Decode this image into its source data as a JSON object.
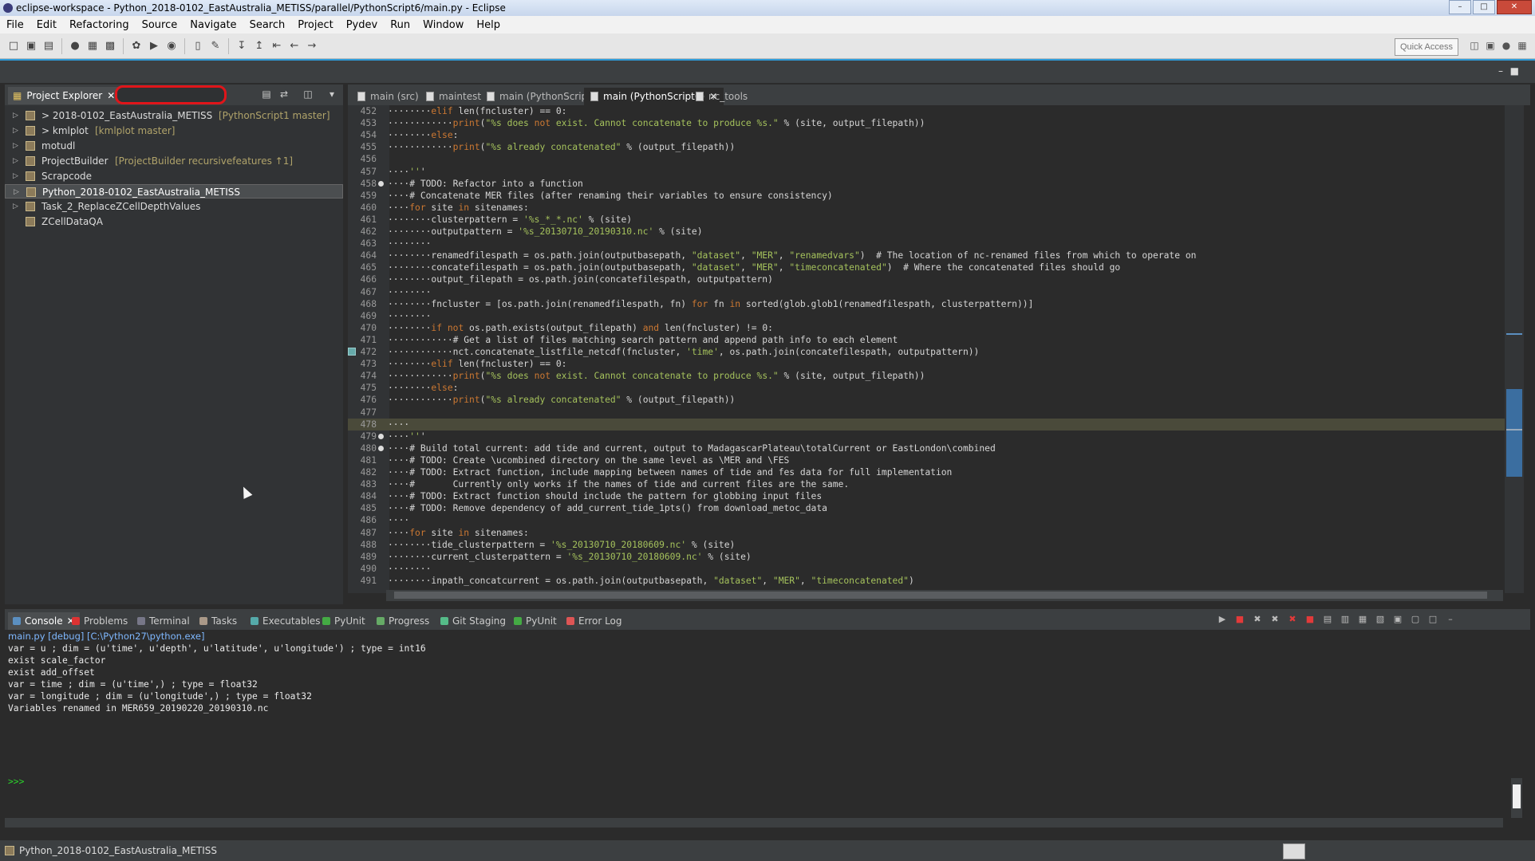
{
  "window": {
    "title": "eclipse-workspace - Python_2018-0102_EastAustralia_METISS/parallel/PythonScript6/main.py - Eclipse",
    "minimize": "–",
    "maximize": "□",
    "close": "✕"
  },
  "menu": [
    "File",
    "Edit",
    "Refactoring",
    "Source",
    "Navigate",
    "Search",
    "Project",
    "Pydev",
    "Run",
    "Window",
    "Help"
  ],
  "toolbar": {
    "quick_access": "Quick Access"
  },
  "project_explorer": {
    "tab_label": "Project Explorer",
    "filter_value": "",
    "items": [
      {
        "label": "> 2018-0102_EastAustralia_METISS",
        "decoration": "[PythonScript1 master]",
        "expandable": true,
        "selected": false
      },
      {
        "label": "> kmlplot",
        "decoration": "[kmlplot master]",
        "expandable": true,
        "selected": false
      },
      {
        "label": "motudl",
        "decoration": "",
        "expandable": true,
        "selected": false
      },
      {
        "label": "ProjectBuilder",
        "decoration": "[ProjectBuilder recursivefeatures ↑1]",
        "expandable": true,
        "selected": false
      },
      {
        "label": "Scrapcode",
        "decoration": "",
        "expandable": true,
        "selected": false
      },
      {
        "label": "Python_2018-0102_EastAustralia_METISS",
        "decoration": "",
        "expandable": true,
        "selected": true
      },
      {
        "label": "Task_2_ReplaceZCellDepthValues",
        "decoration": "",
        "expandable": true,
        "selected": false
      },
      {
        "label": "ZCellDataQA",
        "decoration": "",
        "expandable": false,
        "selected": false
      }
    ]
  },
  "editor": {
    "tabs": [
      {
        "label": "main (src)",
        "active": false
      },
      {
        "label": "maintest",
        "active": false
      },
      {
        "label": "main (PythonScripts)",
        "active": false
      },
      {
        "label": "main (PythonScript6)",
        "active": true
      },
      {
        "label": "nc_tools",
        "active": false
      }
    ],
    "lines": [
      {
        "n": "452",
        "t": "········elif len(fncluster) == 0:"
      },
      {
        "n": "453",
        "t": "············print(\"%s does not exist. Cannot concatenate to produce %s.\" % (site, output_filepath))"
      },
      {
        "n": "454",
        "t": "········else:"
      },
      {
        "n": "455",
        "t": "············print(\"%s already concatenated\" % (output_filepath))"
      },
      {
        "n": "456",
        "t": ""
      },
      {
        "n": "457",
        "t": "····'''"
      },
      {
        "n": "458",
        "t": "····# TODO: Refactor into a function"
      },
      {
        "n": "459",
        "t": "····# Concatenate MER files (after renaming their variables to ensure consistency)"
      },
      {
        "n": "460",
        "t": "····for site in sitenames:"
      },
      {
        "n": "461",
        "t": "········clusterpattern = '%s_*_*.nc' % (site)"
      },
      {
        "n": "462",
        "t": "········outputpattern = '%s_20130710_20190310.nc' % (site)"
      },
      {
        "n": "463",
        "t": "········"
      },
      {
        "n": "464",
        "t": "········renamedfilespath = os.path.join(outputbasepath, \"dataset\", \"MER\", \"renamedvars\")  # The location of nc-renamed files from which to operate on"
      },
      {
        "n": "465",
        "t": "········concatefilespath = os.path.join(outputbasepath, \"dataset\", \"MER\", \"timeconcatenated\")  # Where the concatenated files should go"
      },
      {
        "n": "466",
        "t": "········output_filepath = os.path.join(concatefilespath, outputpattern)"
      },
      {
        "n": "467",
        "t": "········"
      },
      {
        "n": "468",
        "t": "········fncluster = [os.path.join(renamedfilespath, fn) for fn in sorted(glob.glob1(renamedfilespath, clusterpattern))]"
      },
      {
        "n": "469",
        "t": "········"
      },
      {
        "n": "470",
        "t": "········if not os.path.exists(output_filepath) and len(fncluster) != 0:"
      },
      {
        "n": "471",
        "t": "············# Get a list of files matching search pattern and append path info to each element"
      },
      {
        "n": "472",
        "t": "············nct.concatenate_listfile_netcdf(fncluster, 'time', os.path.join(concatefilespath, outputpattern))"
      },
      {
        "n": "473",
        "t": "········elif len(fncluster) == 0:"
      },
      {
        "n": "474",
        "t": "············print(\"%s does not exist. Cannot concatenate to produce %s.\" % (site, output_filepath))"
      },
      {
        "n": "475",
        "t": "········else:"
      },
      {
        "n": "476",
        "t": "············print(\"%s already concatenated\" % (output_filepath))"
      },
      {
        "n": "477",
        "t": ""
      },
      {
        "n": "478",
        "t": "····"
      },
      {
        "n": "479",
        "t": "····'''"
      },
      {
        "n": "480",
        "t": "····# Build total current: add tide and current, output to MadagascarPlateau\\totalCurrent or EastLondon\\combined"
      },
      {
        "n": "481",
        "t": "····# TODO: Create \\ucombined directory on the same level as \\MER and \\FES"
      },
      {
        "n": "482",
        "t": "····# TODO: Extract function, include mapping between names of tide and fes data for full implementation"
      },
      {
        "n": "483",
        "t": "····#       Currently only works if the names of tide and current files are the same."
      },
      {
        "n": "484",
        "t": "····# TODO: Extract function should include the pattern for globbing input files"
      },
      {
        "n": "485",
        "t": "····# TODO: Remove dependency of add_current_tide_1pts() from download_metoc_data"
      },
      {
        "n": "486",
        "t": "····"
      },
      {
        "n": "487",
        "t": "····for site in sitenames:"
      },
      {
        "n": "488",
        "t": "········tide_clusterpattern = '%s_20130710_20180609.nc' % (site)"
      },
      {
        "n": "489",
        "t": "········current_clusterpattern = '%s_20130710_20180609.nc' % (site)"
      },
      {
        "n": "490",
        "t": "········"
      },
      {
        "n": "491",
        "t": "········inpath_concatcurrent = os.path.join(outputbasepath, \"dataset\", \"MER\", \"timeconcatenated\")"
      }
    ]
  },
  "console": {
    "tabs": [
      {
        "label": "Console",
        "active": true
      },
      {
        "label": "Problems",
        "active": false
      },
      {
        "label": "Terminal",
        "active": false
      },
      {
        "label": "Tasks",
        "active": false
      },
      {
        "label": "Executables",
        "active": false
      },
      {
        "label": "PyUnit",
        "active": false
      },
      {
        "label": "Progress",
        "active": false
      },
      {
        "label": "Git Staging",
        "active": false
      },
      {
        "label": "PyUnit",
        "active": false
      },
      {
        "label": "Error Log",
        "active": false
      }
    ],
    "process": "main.py [debug] [C:\\Python27\\python.exe]",
    "output": [
      "var = u ; dim = (u'time', u'depth', u'latitude', u'longitude') ; type = int16",
      "exist scale_factor",
      "exist add_offset",
      "var = time ; dim = (u'time',) ; type = float32",
      "var = longitude ; dim = (u'longitude',) ; type = float32",
      "Variables renamed in MER659_20190220_20190310.nc"
    ],
    "prompt": ">>>"
  },
  "status": {
    "text": "Python_2018-0102_EastAustralia_METISS"
  },
  "colors": {
    "keyword": "#cc7832",
    "string": "#a5c25c",
    "accent": "#2f9bd8",
    "filter_highlight": "#e0151a"
  }
}
